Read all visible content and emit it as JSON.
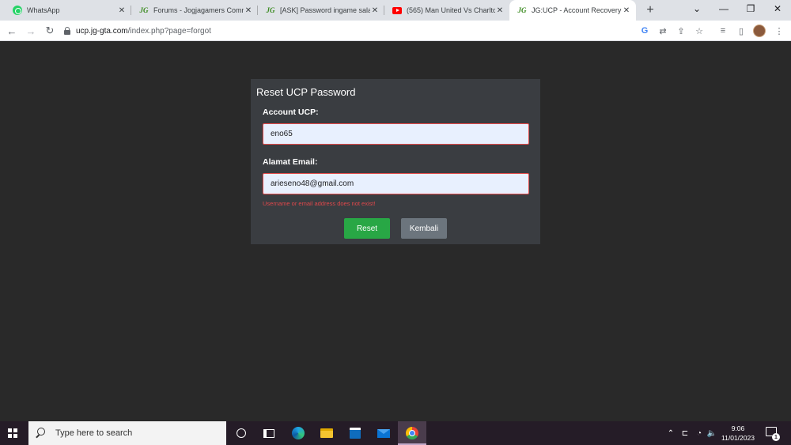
{
  "browser": {
    "tabs": [
      {
        "title": "WhatsApp",
        "icon": "whatsapp-icon",
        "active": false
      },
      {
        "title": "Forums - Jogjagamers Comm",
        "icon": "jg-icon",
        "active": false
      },
      {
        "title": "[ASK] Password ingame salah",
        "icon": "jg-icon",
        "active": false
      },
      {
        "title": "(565) Man United Vs Charlto",
        "icon": "youtube-icon",
        "active": false
      },
      {
        "title": "JG:UCP - Account Recovery",
        "icon": "jg-icon",
        "active": true
      }
    ],
    "jg_favicon_text": "JG",
    "url_host": "ucp.jg-gta.com",
    "url_path": "/index.php?page=forgot"
  },
  "form": {
    "title": "Reset UCP Password",
    "account_label": "Account UCP:",
    "account_value": "eno65",
    "email_label": "Alamat Email:",
    "email_value": "arieseno48@gmail.com",
    "error_text": "Username or email address does not exist!",
    "reset_label": "Reset",
    "back_label": "Kembali"
  },
  "taskbar": {
    "search_placeholder": "Type here to search",
    "time": "9:06",
    "date": "11/01/2023",
    "notification_count": "1"
  },
  "colors": {
    "page_bg": "#292929",
    "card_bg": "#3a3d41",
    "reset_button": "#28a745",
    "back_button": "#6c757d",
    "error": "#e0484b"
  }
}
